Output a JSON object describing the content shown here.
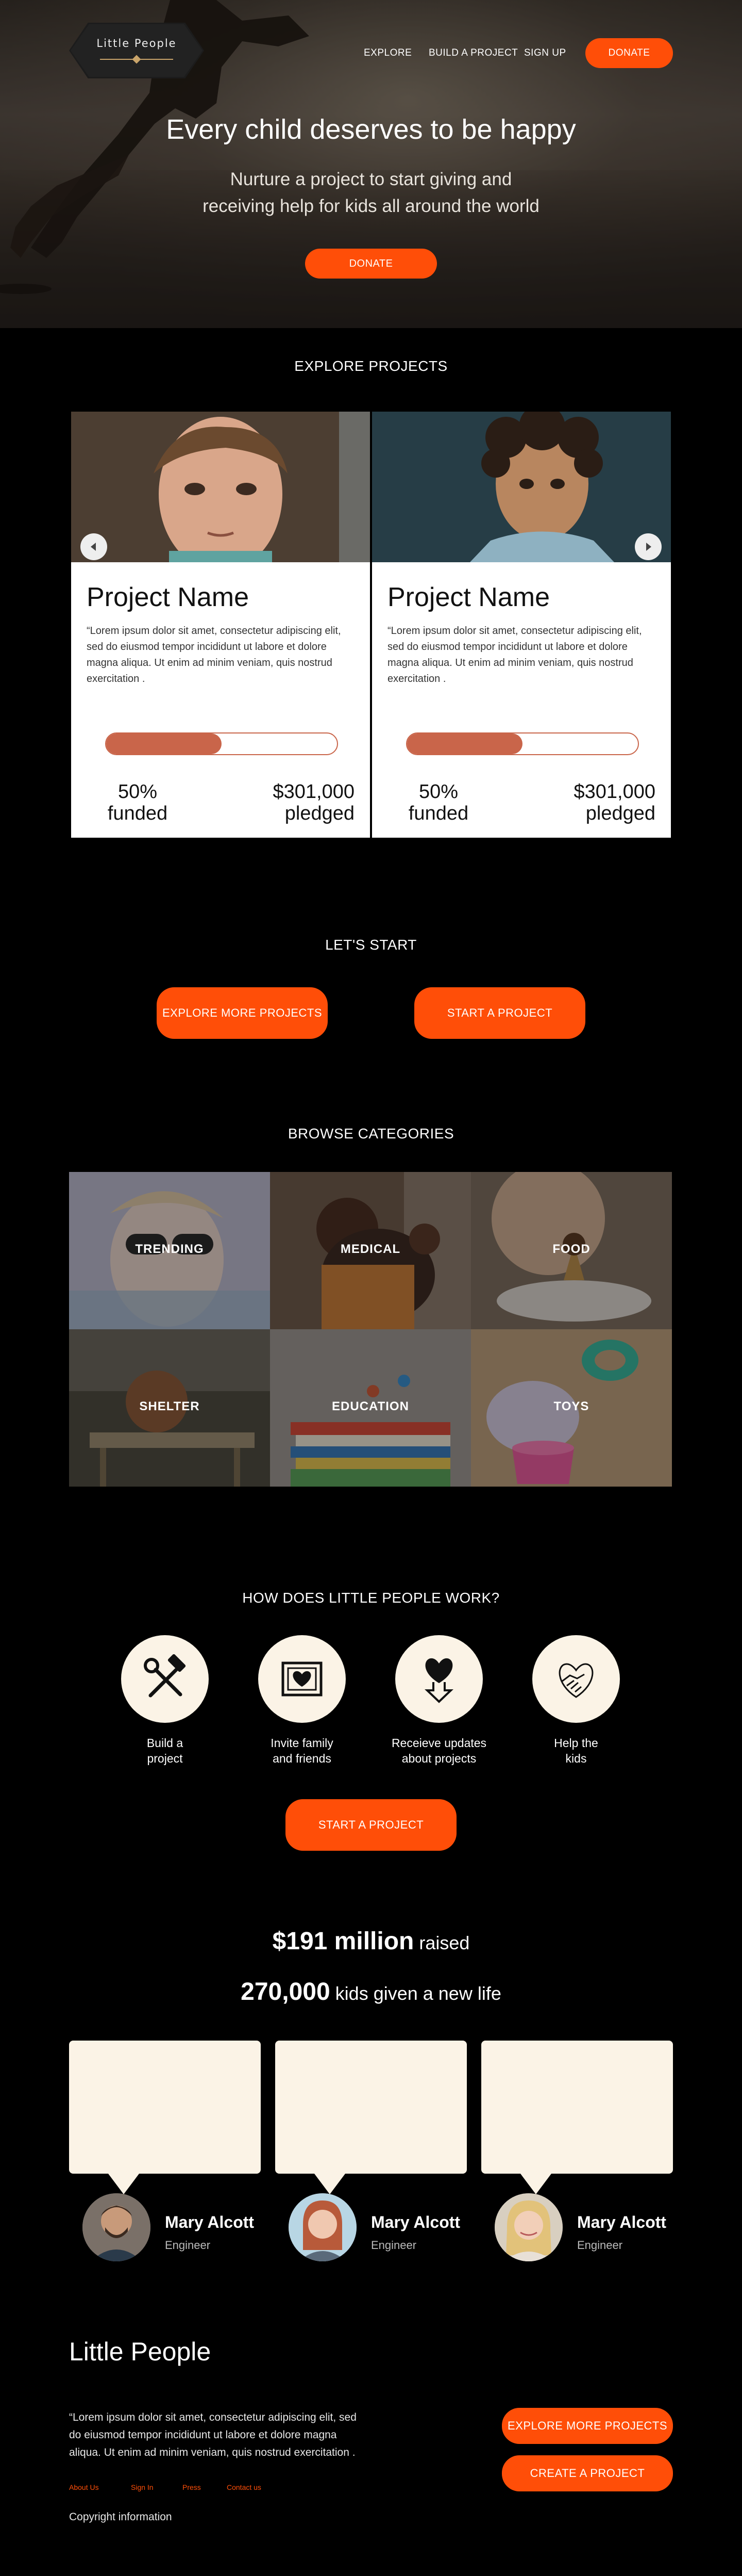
{
  "header": {
    "logo_text": "Little People",
    "nav": [
      "EXPLORE",
      "BUILD A PROJECT",
      "SIGN UP"
    ],
    "donate_label": "DONATE"
  },
  "hero": {
    "title": "Every child deserves to be happy",
    "subtitle_line1": "Nurture a project to start giving and",
    "subtitle_line2": "receiving help for kids all around the world",
    "donate_label": "DONATE"
  },
  "explore": {
    "title": "EXPLORE PROJECTS",
    "projects": [
      {
        "name": "Project Name",
        "description": "“Lorem ipsum dolor sit amet, consectetur adipiscing elit, sed do eiusmod tempor incididunt ut labore et dolore magna aliqua. Ut enim ad minim veniam, quis nostrud exercitation .",
        "funded_percent": 50,
        "funded_value": "50%",
        "funded_label": "funded",
        "pledged_value": "$301,000",
        "pledged_label": "pledged"
      },
      {
        "name": "Project Name",
        "description": "“Lorem ipsum dolor sit amet, consectetur adipiscing elit, sed do eiusmod tempor incididunt ut labore et dolore magna aliqua. Ut enim ad minim veniam, quis nostrud exercitation .",
        "funded_percent": 50,
        "funded_value": "50%",
        "funded_label": "funded",
        "pledged_value": "$301,000",
        "pledged_label": "pledged"
      }
    ],
    "prev_icon": "arrow-left-icon",
    "next_icon": "arrow-right-icon"
  },
  "start": {
    "title": "LET'S START",
    "explore_label": "EXPLORE MORE PROJECTS",
    "start_label": "START A PROJECT"
  },
  "categories": {
    "title": "BROWSE CATEGORIES",
    "items": [
      "TRENDING",
      "MEDICAL",
      "FOOD",
      "SHELTER",
      "EDUCATION",
      "TOYS"
    ]
  },
  "how": {
    "title": "HOW DOES LITTLE PEOPLE WORK?",
    "steps": [
      {
        "line1": "Build a",
        "line2": "project",
        "icon": "hammer-wrench-icon"
      },
      {
        "line1": "Invite family",
        "line2": "and friends",
        "icon": "heart-photo-icon"
      },
      {
        "line1": "Receieve updates",
        "line2": "about projects",
        "icon": "heart-download-icon"
      },
      {
        "line1": "Help the",
        "line2": "kids",
        "icon": "heart-hands-icon"
      }
    ],
    "start_label": "START A PROJECT"
  },
  "stats": {
    "raised_value": "$191 million",
    "raised_label": "raised",
    "kids_value": "270,000",
    "kids_label": "kids given a new life"
  },
  "testimonials": [
    {
      "name": "Mary Alcott",
      "role": "Engineer"
    },
    {
      "name": "Mary Alcott",
      "role": "Engineer"
    },
    {
      "name": "Mary Alcott",
      "role": "Engineer"
    }
  ],
  "footer": {
    "title": "Little People",
    "text": "“Lorem ipsum dolor sit amet, consectetur adipiscing elit, sed do eiusmod tempor incididunt ut labore et dolore magna aliqua. Ut enim ad minim veniam, quis nostrud exercitation .",
    "links": [
      "About Us",
      "Sign In",
      "Press",
      "Contact us"
    ],
    "copyright": "Copyright information",
    "explore_label": "EXPLORE MORE PROJECTS",
    "create_label": "CREATE A PROJECT"
  },
  "colors": {
    "accent": "#ff4e08",
    "progress": "#c9654a",
    "cream": "#fbf3e6",
    "background": "#000000"
  }
}
